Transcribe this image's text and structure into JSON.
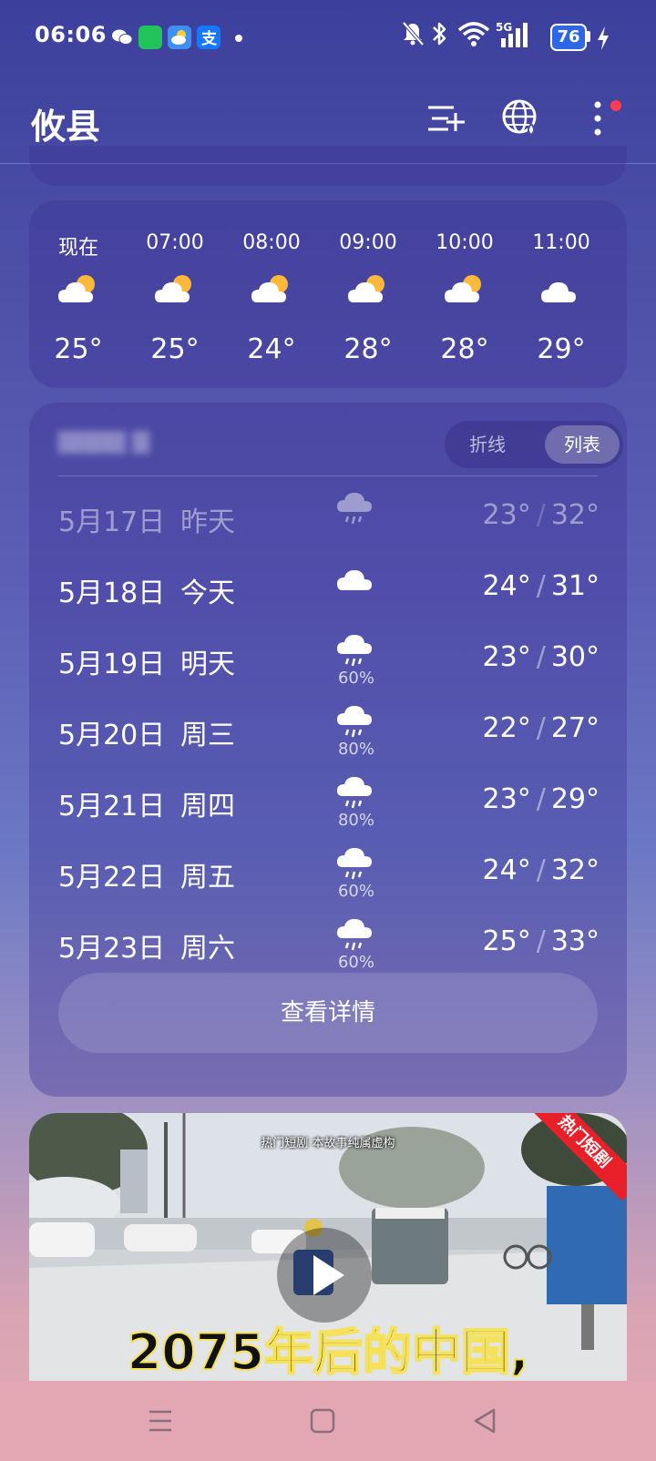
{
  "status_bar": {
    "time": "06:06",
    "battery": "76",
    "icons": [
      "wechat-icon",
      "app-green-icon",
      "weather-app-icon",
      "alipay-icon",
      "mute-icon",
      "bluetooth-icon",
      "wifi-icon",
      "5g-signal-icon",
      "charging-icon"
    ],
    "network_label": "5G"
  },
  "header": {
    "city": "攸县",
    "icons": [
      "add-city-icon",
      "globe-icon",
      "more-icon"
    ]
  },
  "hourly": [
    {
      "time": "现在",
      "temp": "25°",
      "icon": "partly-cloudy-day"
    },
    {
      "time": "07:00",
      "temp": "25°",
      "icon": "partly-cloudy-day"
    },
    {
      "time": "08:00",
      "temp": "24°",
      "icon": "partly-cloudy-day"
    },
    {
      "time": "09:00",
      "temp": "28°",
      "icon": "partly-cloudy-day"
    },
    {
      "time": "10:00",
      "temp": "28°",
      "icon": "partly-cloudy-day"
    },
    {
      "time": "11:00",
      "temp": "29°",
      "icon": "cloudy"
    }
  ],
  "daily": {
    "toggle": {
      "line": "折线",
      "list": "列表",
      "selected": "列表"
    },
    "rows": [
      {
        "date": "5月17日",
        "day": "昨天",
        "icon": "rain",
        "pct": "",
        "low": "23°",
        "high": "32°",
        "past": true
      },
      {
        "date": "5月18日",
        "day": "今天",
        "icon": "cloudy",
        "pct": "",
        "low": "24°",
        "high": "31°",
        "past": false
      },
      {
        "date": "5月19日",
        "day": "明天",
        "icon": "rain",
        "pct": "60%",
        "low": "23°",
        "high": "30°",
        "past": false
      },
      {
        "date": "5月20日",
        "day": "周三",
        "icon": "rain",
        "pct": "80%",
        "low": "22°",
        "high": "27°",
        "past": false
      },
      {
        "date": "5月21日",
        "day": "周四",
        "icon": "rain",
        "pct": "80%",
        "low": "23°",
        "high": "29°",
        "past": false
      },
      {
        "date": "5月22日",
        "day": "周五",
        "icon": "rain",
        "pct": "60%",
        "low": "24°",
        "high": "32°",
        "past": false
      },
      {
        "date": "5月23日",
        "day": "周六",
        "icon": "rain",
        "pct": "60%",
        "low": "25°",
        "high": "33°",
        "past": false
      }
    ],
    "details_button": "查看详情"
  },
  "video_ad": {
    "caption_top": "热门短剧 本故事纯属虚构",
    "ribbon": "热门短剧",
    "headline": "2075年后的中国,"
  },
  "colors": {
    "bg_top": "#3c3f9c",
    "bg_bottom": "#e7aab7",
    "notification_dot": "#ff3b4e",
    "battery": "#2f66e6",
    "ribbon": "#e8202a"
  }
}
